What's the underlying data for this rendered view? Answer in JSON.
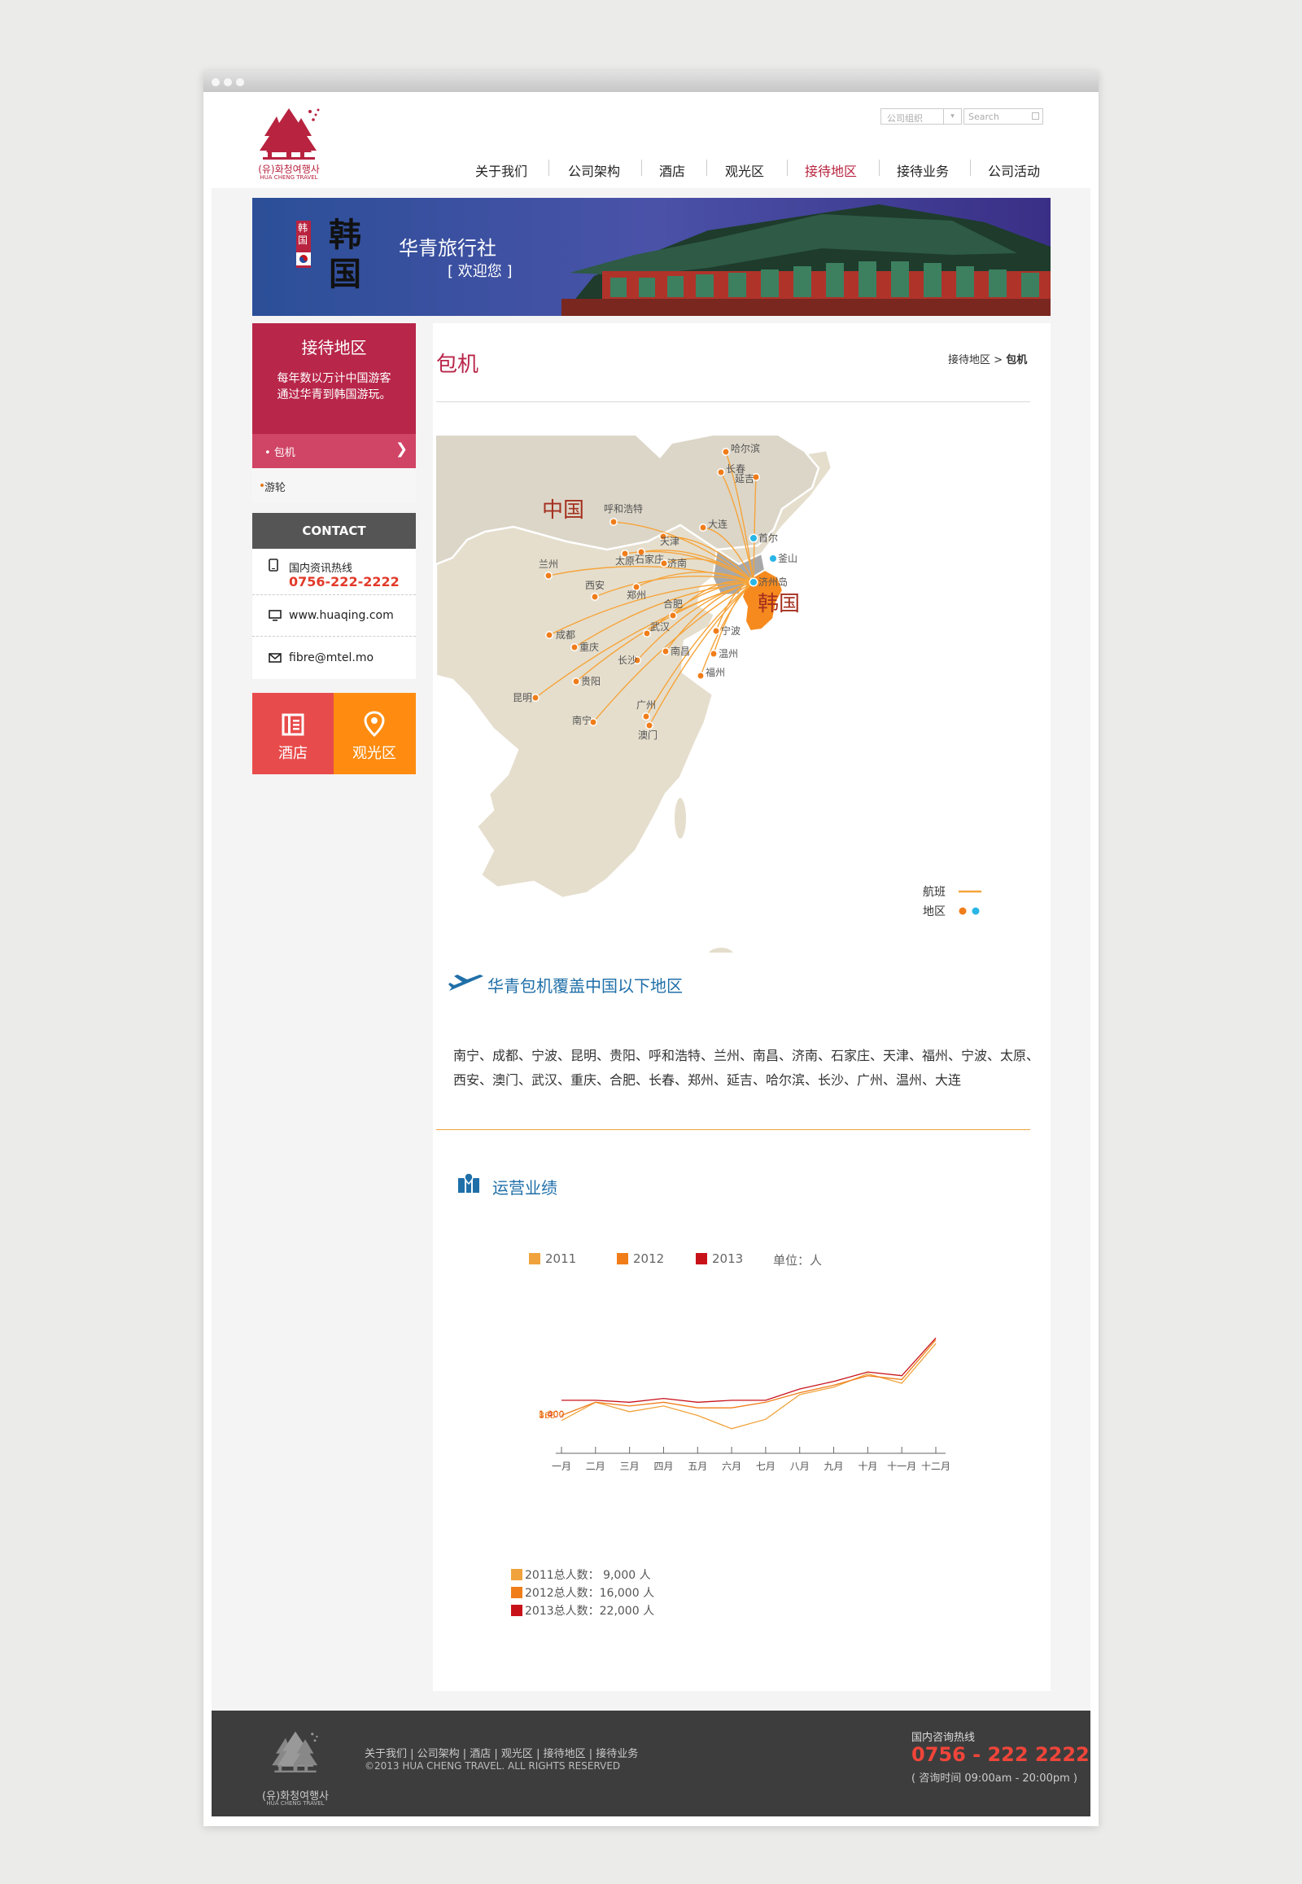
{
  "header": {
    "logo_ko": "(유)화청여행사",
    "logo_en": "HUA CHENG TRAVEL",
    "search_select": "公司组织",
    "search_placeholder": "Search",
    "nav": [
      "关于我们",
      "公司架构",
      "酒店",
      "观光区",
      "接待地区",
      "接待业务",
      "公司活动"
    ],
    "active_nav": "接待地区"
  },
  "banner": {
    "vertical_text": "韩国",
    "calligraphy": "韩国",
    "title": "华青旅行社",
    "subtitle": "[ 欢迎您 ]"
  },
  "sidebar": {
    "title": "接待地区",
    "desc_line1": "每年数以万计中国游客",
    "desc_line2": "通过华青到韩国游玩。",
    "items": [
      {
        "label": "• 包机",
        "active": true
      },
      {
        "label": "游轮",
        "active": false
      }
    ],
    "contact_title": "CONTACT",
    "hotline_label": "国内资讯热线",
    "hotline": "0756-222-2222",
    "website": "www.huaqing.com",
    "email": "fibre@mtel.mo",
    "tiles": [
      {
        "label": "酒店",
        "color": "#e84b4b",
        "icon": "hotel-icon"
      },
      {
        "label": "观光区",
        "color": "#ff8c10",
        "icon": "map-pin-icon"
      }
    ]
  },
  "main": {
    "title": "包机",
    "breadcrumb_parent": "接待地区",
    "breadcrumb_sep": " > ",
    "breadcrumb_current": "包机",
    "map": {
      "china_label": "中国",
      "korea_label": "韩国",
      "china_cities": [
        "哈尔滨",
        "长春",
        "延吉",
        "呼和浩特",
        "大连",
        "天津",
        "太原",
        "石家庄",
        "济南",
        "兰州",
        "西安",
        "郑州",
        "合肥",
        "成都",
        "重庆",
        "武汉",
        "宁波",
        "南昌",
        "温州",
        "长沙",
        "贵阳",
        "福州",
        "昆明",
        "广州",
        "南宁",
        "澳门"
      ],
      "korea_cities": [
        "首尔",
        "釜山",
        "济州岛"
      ],
      "legend_route": "航班",
      "legend_area": "地区",
      "route_color": "#f6a43a",
      "china_dot_color": "#f07d1a",
      "korea_dot_color": "#29b6e6"
    },
    "coverage_title": "华青包机覆盖中国以下地区",
    "coverage_line1": "南宁、成都、宁波、昆明、贵阳、呼和浩特、兰州、南昌、济南、石家庄、天津、福州、宁波、太原、",
    "coverage_line2": "西安、澳门、武汉、重庆、合肥、长春、郑州、延吉、哈尔滨、长沙、广州、温州、大连",
    "perf_title": "运营业绩",
    "unit_label": "单位：人",
    "totals": [
      "2011总人数：  9,000  人",
      "2012总人数：16,000  人",
      "2013总人数：22,000  人"
    ]
  },
  "chart_data": {
    "type": "line",
    "title": "",
    "xlabel": "",
    "ylabel": "",
    "unit": "单位：人",
    "categories": [
      "一月",
      "二月",
      "三月",
      "四月",
      "五月",
      "六月",
      "七月",
      "八月",
      "九月",
      "十月",
      "十一月",
      "十二月"
    ],
    "ylim": [
      0,
      3400
    ],
    "y_labels": [
      {
        "value": 1400,
        "text": "1,400",
        "color": "#c8121a"
      },
      {
        "value": 1000,
        "text": "1,000",
        "color": "#f07d1a"
      },
      {
        "value": 865,
        "text": "865",
        "color": "#f07d1a"
      }
    ],
    "series": [
      {
        "name": "2011",
        "color": "#f0a33c",
        "values": [
          865,
          1350,
          1100,
          1250,
          1000,
          650,
          900,
          1550,
          1750,
          2100,
          1850,
          2900
        ]
      },
      {
        "name": "2012",
        "color": "#f07d1a",
        "values": [
          1000,
          1350,
          1250,
          1350,
          1200,
          1200,
          1350,
          1600,
          1800,
          2050,
          1950,
          3000
        ]
      },
      {
        "name": "2013",
        "color": "#c8121a",
        "values": [
          1400,
          1400,
          1350,
          1450,
          1350,
          1400,
          1400,
          1700,
          1900,
          2150,
          2050,
          3050
        ]
      }
    ]
  },
  "footer": {
    "logo_ko": "(유)화청여행사",
    "logo_en": "HUA CHENG TRAVEL",
    "links": "关于我们 | 公司架构 | 酒店 | 观光区 | 接待地区 | 接待业务",
    "copyright": "©2013 HUA CHENG TRAVEL. ALL RIGHTS RESERVED",
    "hotline_label": "国内咨询热线",
    "phone": "0756 - 222 2222",
    "hours": "( 咨询时间 09:00am - 20:00pm )"
  }
}
